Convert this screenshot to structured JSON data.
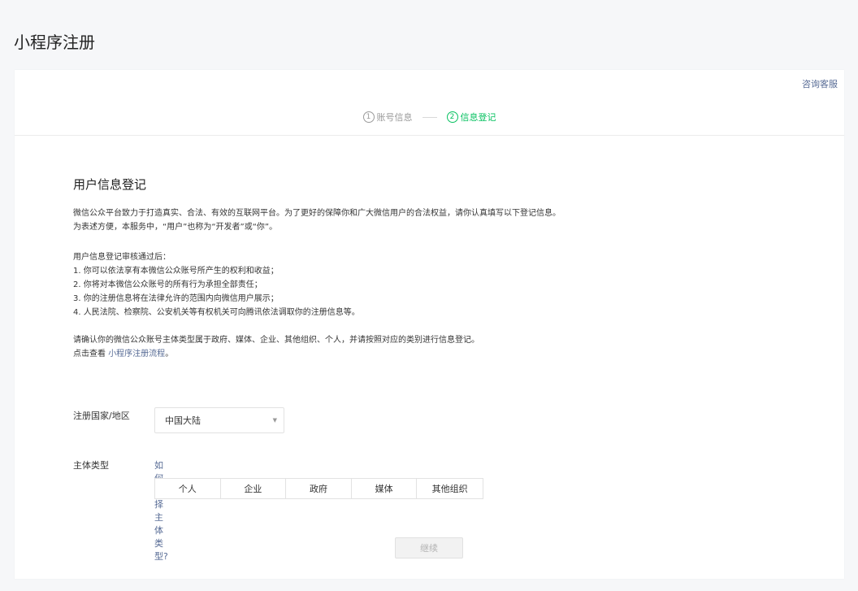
{
  "page": {
    "title": "小程序注册"
  },
  "header": {
    "consult_link": "咨询客服"
  },
  "steps": [
    {
      "num": "1",
      "label": "账号信息",
      "active": false
    },
    {
      "num": "2",
      "label": "信息登记",
      "active": true
    }
  ],
  "section": {
    "title": "用户信息登记",
    "intro_lines": [
      "微信公众平台致力于打造真实、合法、有效的互联网平台。为了更好的保障你和广大微信用户的合法权益，请你认真填写以下登记信息。",
      "为表述方便，本服务中，“用户”也称为“开发者”或“你”。"
    ],
    "rules_title": "用户信息登记审核通过后：",
    "rules": [
      "1. 你可以依法享有本微信公众账号所产生的权利和收益；",
      "2. 你将对本微信公众账号的所有行为承担全部责任；",
      "3. 你的注册信息将在法律允许的范围内向微信用户展示；",
      "4. 人民法院、检察院、公安机关等有权机关可向腾讯依法调取你的注册信息等。"
    ],
    "confirm_line": "请确认你的微信公众账号主体类型属于政府、媒体、企业、其他组织、个人，并请按照对应的类别进行信息登记。",
    "view_prefix": "点击查看",
    "view_link": "小程序注册流程",
    "view_suffix": "。"
  },
  "form": {
    "region_label": "注册国家/地区",
    "region_value": "中国大陆",
    "region_arrow": "▼",
    "type_label": "主体类型",
    "type_help": "如何选择主体类型?",
    "type_options": [
      "个人",
      "企业",
      "政府",
      "媒体",
      "其他组织"
    ]
  },
  "actions": {
    "continue_label": "继续"
  },
  "colors": {
    "accent_green": "#07c160",
    "link_blue": "#576b95",
    "muted": "#9a9a9a"
  }
}
